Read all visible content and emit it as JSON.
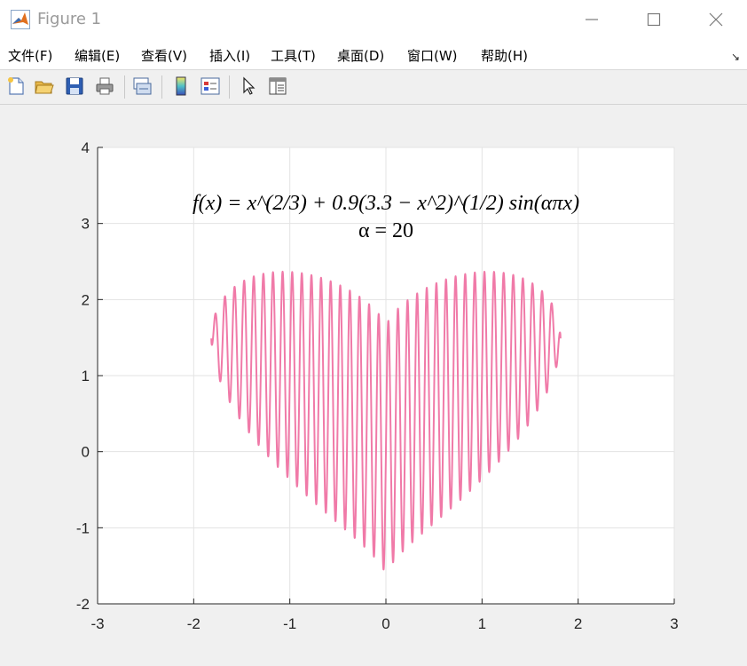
{
  "window": {
    "title": "Figure 1",
    "minimize_icon": "minimize-icon",
    "maximize_icon": "maximize-icon",
    "close_icon": "close-icon"
  },
  "menu": {
    "items": [
      {
        "label": "文件(F)"
      },
      {
        "label": "编辑(E)"
      },
      {
        "label": "查看(V)"
      },
      {
        "label": "插入(I)"
      },
      {
        "label": "工具(T)"
      },
      {
        "label": "桌面(D)"
      },
      {
        "label": "窗口(W)"
      },
      {
        "label": "帮助(H)"
      }
    ],
    "dock_arrow": "↘"
  },
  "toolbar": {
    "buttons": [
      {
        "icon": "new-figure-icon"
      },
      {
        "icon": "open-file-icon"
      },
      {
        "icon": "save-icon"
      },
      {
        "icon": "print-icon"
      },
      {
        "icon": "link-plot-icon"
      },
      {
        "icon": "insert-colorbar-icon"
      },
      {
        "icon": "insert-legend-icon"
      },
      {
        "icon": "edit-plot-arrow-icon"
      },
      {
        "icon": "property-inspector-icon"
      }
    ]
  },
  "colors": {
    "curve": "#f07aa8",
    "grid": "#e3e3e3",
    "axis": "#262626"
  },
  "chart_data": {
    "type": "line",
    "function": "f(x) = x^(2/3) + 0.9(3.3 - x^2)^(1/2) sin(απx)",
    "parameter_alpha": 20,
    "annotation": {
      "line1": "f(x) = x^(2/3) + 0.9(3.3 − x^2)^(1/2) sin(απx)",
      "line2": "α = 20"
    },
    "x_domain": [
      -1.8166,
      1.8166
    ],
    "xlim": [
      -3,
      3
    ],
    "ylim": [
      -2,
      4
    ],
    "xticks": [
      "-3",
      "-2",
      "-1",
      "0",
      "1",
      "2",
      "3"
    ],
    "yticks": [
      "-2",
      "-1",
      "0",
      "1",
      "2",
      "3",
      "4"
    ],
    "grid": true,
    "series": [
      {
        "color": "#f07aa8"
      }
    ]
  }
}
